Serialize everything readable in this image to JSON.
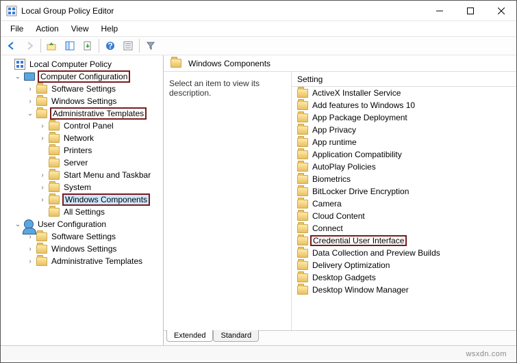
{
  "window": {
    "title": "Local Group Policy Editor"
  },
  "menu": {
    "file": "File",
    "action": "Action",
    "view": "View",
    "help": "Help"
  },
  "tree": {
    "root": "Local Computer Policy",
    "comp_config": "Computer Configuration",
    "soft_settings": "Software Settings",
    "win_settings": "Windows Settings",
    "admin_templates": "Administrative Templates",
    "control_panel": "Control Panel",
    "network": "Network",
    "printers": "Printers",
    "server": "Server",
    "start_menu": "Start Menu and Taskbar",
    "system": "System",
    "win_components": "Windows Components",
    "all_settings": "All Settings",
    "user_config": "User Configuration",
    "u_soft": "Software Settings",
    "u_win": "Windows Settings",
    "u_admin": "Administrative Templates"
  },
  "right": {
    "heading": "Windows Components",
    "desc": "Select an item to view its description.",
    "setting_head": "Setting",
    "items": [
      "ActiveX Installer Service",
      "Add features to Windows 10",
      "App Package Deployment",
      "App Privacy",
      "App runtime",
      "Application Compatibility",
      "AutoPlay Policies",
      "Biometrics",
      "BitLocker Drive Encryption",
      "Camera",
      "Cloud Content",
      "Connect",
      "Credential User Interface",
      "Data Collection and Preview Builds",
      "Delivery Optimization",
      "Desktop Gadgets",
      "Desktop Window Manager"
    ],
    "highlight_index": 12
  },
  "tabs": {
    "extended": "Extended",
    "standard": "Standard"
  },
  "watermark": "wsxdn.com"
}
